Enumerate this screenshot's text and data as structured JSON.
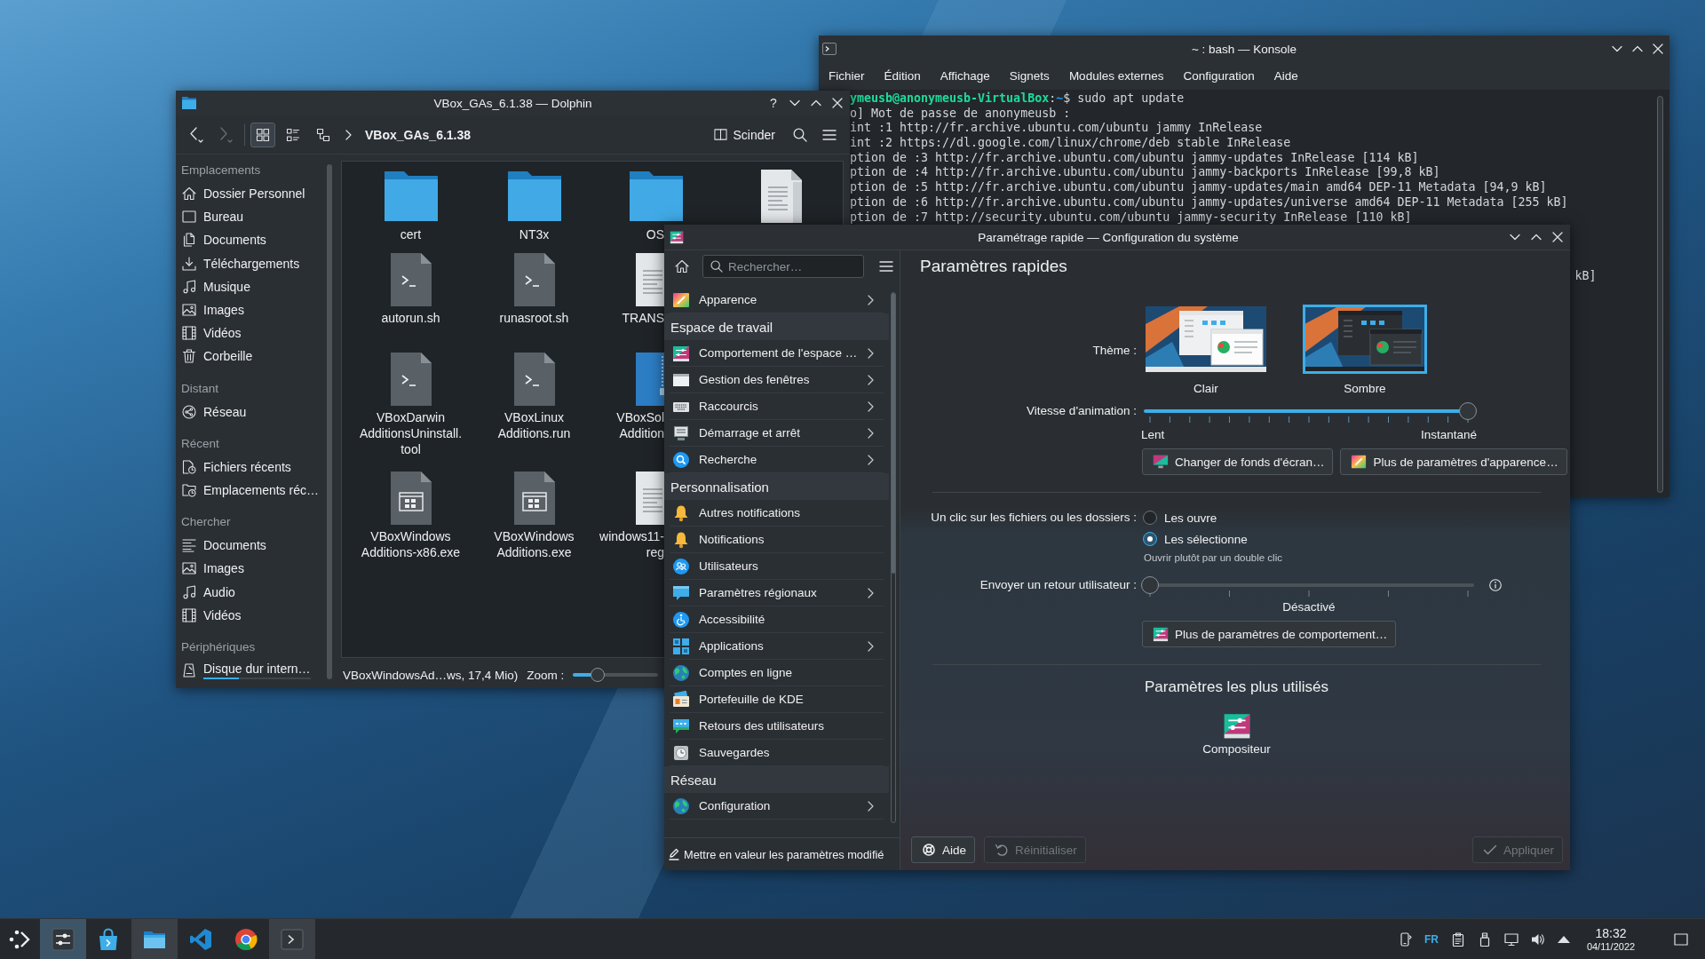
{
  "konsole": {
    "title": "~ : bash — Konsole",
    "menu": [
      "Fichier",
      "Édition",
      "Affichage",
      "Signets",
      "Modules externes",
      "Configuration",
      "Aide"
    ],
    "lines": [
      [
        {
          "kind": "host",
          "text": "ymeusb@anonymeusb-VirtualBox"
        },
        {
          "kind": "plain",
          "text": ":"
        },
        {
          "kind": "path",
          "text": "~"
        },
        {
          "kind": "plain",
          "text": "$ sudo apt update"
        }
      ],
      [
        {
          "kind": "plain",
          "text": "o] Mot de passe de anonymeusb :"
        }
      ],
      [
        {
          "kind": "plain",
          "text": "int :1 http://fr.archive.ubuntu.com/ubuntu jammy InRelease"
        }
      ],
      [
        {
          "kind": "plain",
          "text": "int :2 https://dl.google.com/linux/chrome/deb stable InRelease"
        }
      ],
      [
        {
          "kind": "plain",
          "text": "ption de :3 http://fr.archive.ubuntu.com/ubuntu jammy-updates InRelease [114 kB]"
        }
      ],
      [
        {
          "kind": "plain",
          "text": "ption de :4 http://fr.archive.ubuntu.com/ubuntu jammy-backports InRelease [99,8 kB]"
        }
      ],
      [
        {
          "kind": "plain",
          "text": "ption de :5 http://fr.archive.ubuntu.com/ubuntu jammy-updates/main amd64 DEP-11 Metadata [94,9 kB]"
        }
      ],
      [
        {
          "kind": "plain",
          "text": "ption de :6 http://fr.archive.ubuntu.com/ubuntu jammy-updates/universe amd64 DEP-11 Metadata [255 kB]"
        }
      ],
      [
        {
          "kind": "plain",
          "text": "ption de :7 http://security.ubuntu.com/ubuntu jammy-security InRelease [110 kB]"
        }
      ]
    ],
    "tail_fragment": "kB]"
  },
  "dolphin": {
    "title": "VBox_GAs_6.1.38 — Dolphin",
    "help_button": "?",
    "navigation": [
      {
        "kind": "back",
        "disabled": false
      },
      {
        "kind": "forward",
        "disabled": true
      }
    ],
    "view_modes": [
      {
        "kind": "icons",
        "selected": true
      },
      {
        "kind": "compact",
        "selected": false
      },
      {
        "kind": "details",
        "selected": false
      }
    ],
    "breadcrumb": "VBox_GAs_6.1.38",
    "split_button": "Scinder",
    "places": [
      {
        "heading": "Emplacements",
        "items": [
          {
            "kind": "home",
            "label": "Dossier Personnel"
          },
          {
            "kind": "desktop",
            "label": "Bureau"
          },
          {
            "kind": "documents",
            "label": "Documents"
          },
          {
            "kind": "downloads",
            "label": "Téléchargements"
          },
          {
            "kind": "music",
            "label": "Musique"
          },
          {
            "kind": "pictures",
            "label": "Images"
          },
          {
            "kind": "videos",
            "label": "Vidéos"
          },
          {
            "kind": "trash",
            "label": "Corbeille"
          }
        ]
      },
      {
        "heading": "Distant",
        "items": [
          {
            "kind": "network",
            "label": "Réseau"
          }
        ]
      },
      {
        "heading": "Récent",
        "items": [
          {
            "kind": "recent-files",
            "label": "Fichiers récents"
          },
          {
            "kind": "recent-locations",
            "label": "Emplacements réc…"
          }
        ]
      },
      {
        "heading": "Chercher",
        "items": [
          {
            "kind": "search-documents",
            "label": "Documents"
          },
          {
            "kind": "pictures",
            "label": "Images"
          },
          {
            "kind": "music",
            "label": "Audio"
          },
          {
            "kind": "videos",
            "label": "Vidéos"
          }
        ]
      },
      {
        "heading": "Périphériques",
        "items": [
          {
            "kind": "drive",
            "label": "Disque dur intern…",
            "level": 0.33
          }
        ]
      }
    ],
    "file_rows": [
      [
        {
          "kind": "folder",
          "label": "cert"
        },
        {
          "kind": "folder",
          "label": "NT3x"
        },
        {
          "kind": "folder",
          "label": "OS"
        },
        {
          "kind": "text"
        }
      ],
      [
        {
          "kind": "script",
          "label": "autorun.sh"
        },
        {
          "kind": "script",
          "label": "runasroot.sh"
        },
        {
          "kind": "text",
          "label": "TRANS"
        }
      ],
      [
        {
          "kind": "script",
          "label": "VBoxDarwin\nAdditionsUninstall.\ntool"
        },
        {
          "kind": "script",
          "label": "VBoxLinux\nAdditions.run"
        },
        {
          "kind": "package",
          "label": "VBoxSol\nAddition"
        }
      ],
      [
        {
          "kind": "executable",
          "label": "VBoxWindows\nAdditions-x86.exe"
        },
        {
          "kind": "executable",
          "label": "VBoxWindows\nAdditions.exe"
        },
        {
          "kind": "text",
          "label": "windows11-\nreg"
        }
      ]
    ],
    "status": "VBoxWindowsAd…ws, 17,4 Mio)",
    "zoom_label": "Zoom :",
    "zoom_slider": {
      "level": 0.25
    }
  },
  "settings": {
    "title": "Paramétrage rapide — Configuration du système",
    "search_placeholder": "Rechercher…",
    "sidebar": [
      {
        "kind": "appearance",
        "label": "Apparence",
        "expandable": true
      },
      {
        "kind": "section",
        "label": "Espace de travail"
      },
      {
        "kind": "behavior",
        "label": "Comportement de l'espace …",
        "expandable": true
      },
      {
        "kind": "windows",
        "label": "Gestion des fenêtres",
        "expandable": true
      },
      {
        "kind": "shortcuts",
        "label": "Raccourcis",
        "expandable": true
      },
      {
        "kind": "startup",
        "label": "Démarrage et arrêt",
        "expandable": true
      },
      {
        "kind": "search",
        "label": "Recherche",
        "expandable": true
      },
      {
        "kind": "section",
        "label": "Personnalisation"
      },
      {
        "kind": "notifications",
        "label": "Autres notifications",
        "expandable": false
      },
      {
        "kind": "notifications",
        "label": "Notifications",
        "expandable": false
      },
      {
        "kind": "users",
        "label": "Utilisateurs",
        "expandable": false
      },
      {
        "kind": "regional",
        "label": "Paramètres régionaux",
        "expandable": true
      },
      {
        "kind": "accessibility",
        "label": "Accessibilité",
        "expandable": false
      },
      {
        "kind": "applications",
        "label": "Applications",
        "expandable": true
      },
      {
        "kind": "accounts",
        "label": "Comptes en ligne",
        "expandable": false
      },
      {
        "kind": "wallet",
        "label": "Portefeuille de KDE",
        "expandable": false
      },
      {
        "kind": "feedback",
        "label": "Retours des utilisateurs",
        "expandable": false
      },
      {
        "kind": "backups",
        "label": "Sauvegardes",
        "expandable": false
      },
      {
        "kind": "section",
        "label": "Réseau"
      },
      {
        "kind": "network",
        "label": "Configuration",
        "expandable": true
      }
    ],
    "footer": "Mettre en valeur les paramètres modifié",
    "page_title": "Paramètres rapides",
    "theme": {
      "label": "Thème :",
      "options": [
        {
          "kind": "light",
          "label": "Clair",
          "selected": false
        },
        {
          "kind": "dark",
          "label": "Sombre",
          "selected": true
        }
      ]
    },
    "animation": {
      "label": "Vitesse d'animation :",
      "level": 1,
      "min_label": "Lent",
      "max_label": "Instantané"
    },
    "appearance_buttons": [
      {
        "kind": "wallpaper",
        "label": "Changer de fonds d'écran…"
      },
      {
        "kind": "appearance",
        "label": "Plus de paramètres d'apparence…"
      }
    ],
    "click": {
      "label": "Un clic sur les fichiers ou les dossiers :",
      "options": [
        {
          "label": "Les ouvre",
          "selected": false
        },
        {
          "label": "Les sélectionne",
          "selected": true
        }
      ],
      "hint": "Ouvrir plutôt par un double clic"
    },
    "feedback": {
      "label": "Envoyer un retour utilisateur :",
      "level": 0,
      "value_label": "Désactivé"
    },
    "behavior_button": "Plus de paramètres de comportement…",
    "most_used": {
      "title": "Paramètres les plus utilisés",
      "items": [
        "Compositeur"
      ]
    },
    "buttons": [
      {
        "kind": "help",
        "label": "Aide",
        "disabled": false
      },
      {
        "kind": "reset",
        "label": "Réinitialiser",
        "disabled": true
      },
      {
        "kind": "apply",
        "label": "Appliquer",
        "disabled": true
      }
    ]
  },
  "taskbar": {
    "tasks": [
      {
        "kind": "settings",
        "running": true,
        "selected": true
      },
      {
        "kind": "store",
        "running": false,
        "selected": false
      },
      {
        "kind": "files",
        "running": true,
        "selected": false
      },
      {
        "kind": "code-editor",
        "running": false,
        "selected": false
      },
      {
        "kind": "browser",
        "running": false,
        "selected": false
      },
      {
        "kind": "terminal",
        "running": true,
        "selected": false
      }
    ],
    "keyboard_layout": "FR",
    "time": "18:32",
    "date": "04/11/2022"
  }
}
